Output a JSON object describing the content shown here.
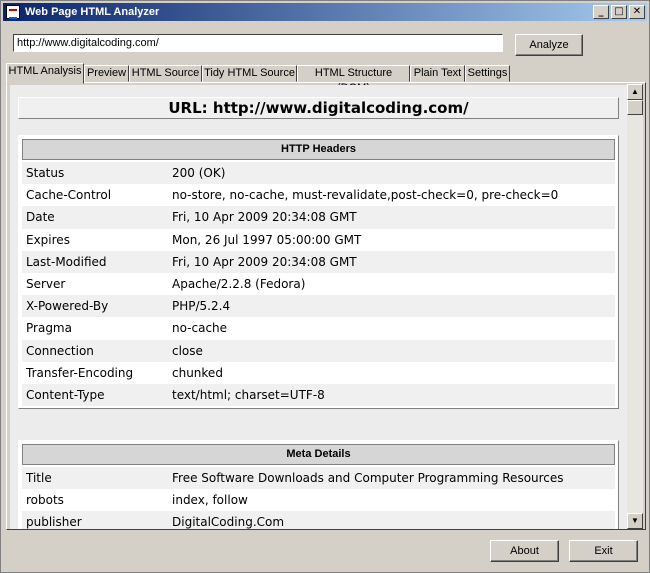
{
  "window": {
    "title": "Web Page HTML Analyzer",
    "minimize": "_",
    "maximize": "□",
    "close": "✕"
  },
  "toolbar": {
    "url_value": "http://www.digitalcoding.com/",
    "analyze_label": "Analyze"
  },
  "tabs": [
    {
      "label": "HTML Analysis",
      "active": true
    },
    {
      "label": "Preview"
    },
    {
      "label": "HTML Source"
    },
    {
      "label": "Tidy HTML Source"
    },
    {
      "label": "HTML Structure (DOM)"
    },
    {
      "label": "Plain Text"
    },
    {
      "label": "Settings"
    }
  ],
  "analysis": {
    "url_heading": "URL: http://www.digitalcoding.com/",
    "http_headers": {
      "title": "HTTP Headers",
      "rows": [
        {
          "key": "Status",
          "value": "200 (OK)"
        },
        {
          "key": "Cache-Control",
          "value": "no-store, no-cache, must-revalidate,post-check=0, pre-check=0"
        },
        {
          "key": "Date",
          "value": "Fri, 10 Apr 2009 20:34:08 GMT"
        },
        {
          "key": "Expires",
          "value": "Mon, 26 Jul 1997 05:00:00 GMT"
        },
        {
          "key": "Last-Modified",
          "value": "Fri, 10 Apr 2009 20:34:08 GMT"
        },
        {
          "key": "Server",
          "value": "Apache/2.2.8 (Fedora)"
        },
        {
          "key": "X-Powered-By",
          "value": "PHP/5.2.4"
        },
        {
          "key": "Pragma",
          "value": "no-cache"
        },
        {
          "key": "Connection",
          "value": "close"
        },
        {
          "key": "Transfer-Encoding",
          "value": "chunked"
        },
        {
          "key": "Content-Type",
          "value": "text/html; charset=UTF-8"
        }
      ]
    },
    "meta_details": {
      "title": "Meta Details",
      "rows": [
        {
          "key": "Title",
          "value": "Free Software Downloads and Computer Programming Resources"
        },
        {
          "key": "robots",
          "value": "index, follow"
        },
        {
          "key": "publisher",
          "value": "DigitalCoding.Com"
        }
      ]
    }
  },
  "scrollbar": {
    "up": "▲",
    "down": "▼"
  },
  "footer": {
    "about_label": "About",
    "exit_label": "Exit"
  }
}
